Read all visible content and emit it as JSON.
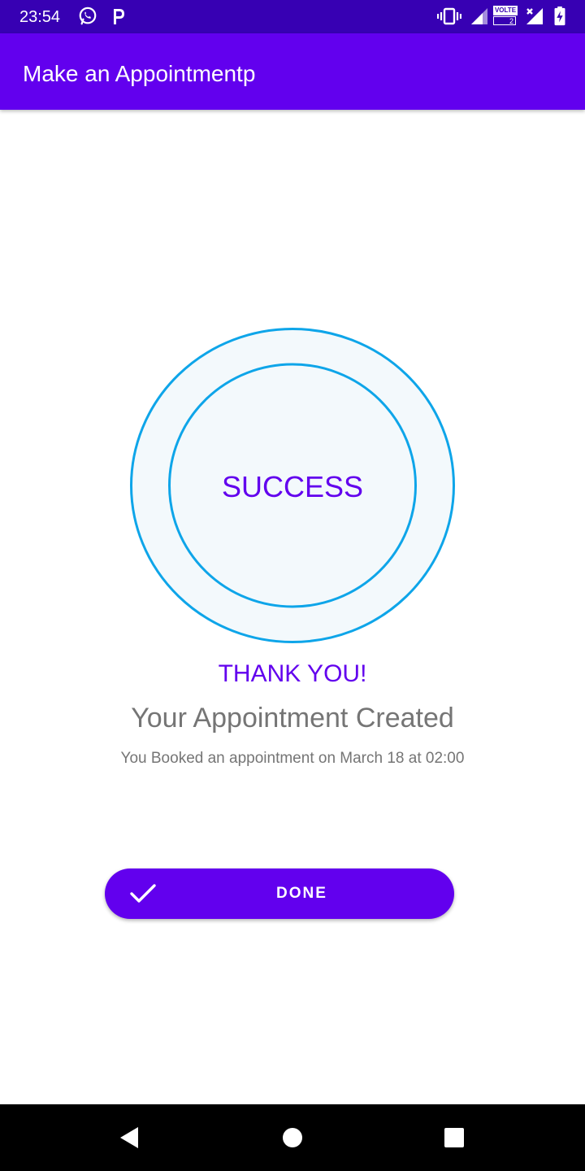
{
  "status_bar": {
    "time": "23:54",
    "left_icons": [
      "whatsapp-icon",
      "parking-p-icon"
    ],
    "right_icons": [
      "vibrate-icon",
      "signal-icon",
      "volte-icon",
      "no-signal-icon",
      "battery-charging-icon"
    ],
    "volte_label": "VOLTE",
    "volte_sub": "2"
  },
  "app_bar": {
    "title": "Make an Appointmentp"
  },
  "success_badge": {
    "label": "SUCCESS"
  },
  "message": {
    "thank_you": "THANK YOU!",
    "headline": "Your Appointment Created",
    "detail": "You Booked an appointment on March 18 at 02:00"
  },
  "done_button": {
    "label": "DONE",
    "icon": "check-icon"
  },
  "nav_bar": {
    "buttons": [
      "back-icon",
      "home-icon",
      "recents-icon"
    ]
  },
  "colors": {
    "status_bar": "#3700b3",
    "app_bar": "#6200ee",
    "accent": "#6200ee",
    "ring_stroke": "#0ea5e9",
    "ring_fill": "#f3f9fc",
    "secondary_text": "#757575"
  }
}
